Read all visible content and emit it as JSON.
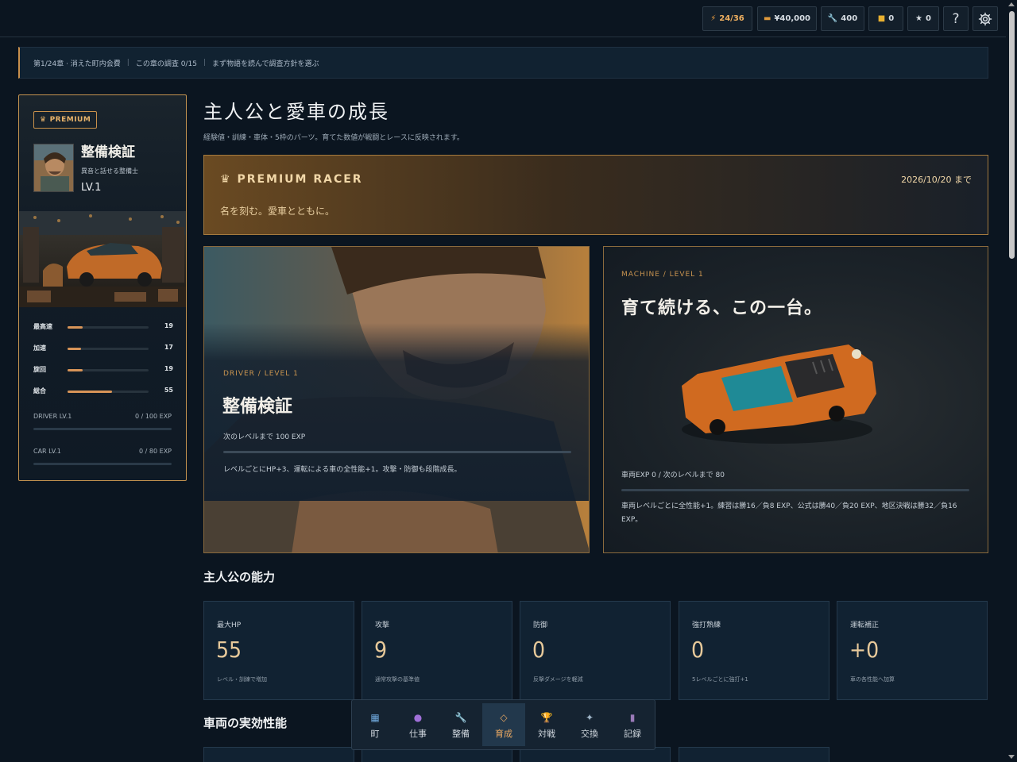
{
  "hud": {
    "energy": "24/36",
    "money": "¥40,000",
    "parts": "400",
    "files": "0",
    "stars": "0",
    "help": "?"
  },
  "breadcrumb": {
    "chapter": "第1/24章 · 消えた町内会費",
    "investigation": "この章の調査 0/15",
    "hint": "まず物語を読んで調査方針を選ぶ"
  },
  "profile": {
    "badge": "PREMIUM",
    "name": "整備検証",
    "subtitle": "異音と話せる整備士",
    "level": "LV.1",
    "stats": [
      {
        "label": "最高速",
        "value": 19,
        "max": 100
      },
      {
        "label": "加速",
        "value": 17,
        "max": 100
      },
      {
        "label": "旋回",
        "value": 19,
        "max": 100
      },
      {
        "label": "総合",
        "value": 55,
        "max": 100
      }
    ],
    "driver_label": "DRIVER LV.1",
    "driver_exp": "0 / 100 EXP",
    "car_label": "CAR LV.1",
    "car_exp": "0 / 80 EXP"
  },
  "main": {
    "title": "主人公と愛車の成長",
    "description": "経験値・訓練・車体・5枠のパーツ。育てた数値が戦闘とレースに反映されます。",
    "premium": {
      "title": "PREMIUM RACER",
      "until": "2026/10/20 まで",
      "tagline": "名を刻む。愛車とともに。"
    },
    "driver": {
      "kicker": "DRIVER / LEVEL 1",
      "name": "整備検証",
      "next": "次のレベルまで 100 EXP",
      "info": "レベルごとにHP+3、運転による車の全性能+1。攻撃・防御も段階成長。"
    },
    "machine": {
      "kicker": "MACHINE / LEVEL 1",
      "title": "育て続ける、この一台。",
      "exp": "車両EXP 0 / 次のレベルまで 80",
      "info": "車両レベルごとに全性能+1。練習は勝16／負8 EXP、公式は勝40／負20 EXP、地区決戦は勝32／負16 EXP。"
    },
    "abilities_title": "主人公の能力",
    "abilities": [
      {
        "label": "最大HP",
        "value": "55",
        "desc": "レベル・訓練で増加"
      },
      {
        "label": "攻撃",
        "value": "9",
        "desc": "通常攻撃の基準値"
      },
      {
        "label": "防御",
        "value": "0",
        "desc": "反撃ダメージを軽減"
      },
      {
        "label": "強打熟練",
        "value": "0",
        "desc": "5レベルごとに強打+1"
      },
      {
        "label": "運転補正",
        "value": "+0",
        "desc": "車の各性能へ加算"
      }
    ],
    "vehicle_title": "車両の実効性能"
  },
  "nav": [
    {
      "icon": "map-icon",
      "glyph": "▦",
      "label": "町",
      "color": "#6fa8dc"
    },
    {
      "icon": "job-icon",
      "glyph": "●",
      "label": "仕事",
      "color": "#a070d8"
    },
    {
      "icon": "wrench-icon",
      "glyph": "🔧",
      "label": "整備",
      "color": "#c8ccd0"
    },
    {
      "icon": "diamond-icon",
      "glyph": "◇",
      "label": "育成",
      "color": "#e9a862",
      "active": true
    },
    {
      "icon": "trophy-icon",
      "glyph": "🏆",
      "label": "対戦",
      "color": "#e0b040"
    },
    {
      "icon": "sparkle-icon",
      "glyph": "✦",
      "label": "交換",
      "color": "#9fb5c8"
    },
    {
      "icon": "book-icon",
      "glyph": "▮",
      "label": "記録",
      "color": "#9a7ab8"
    }
  ]
}
